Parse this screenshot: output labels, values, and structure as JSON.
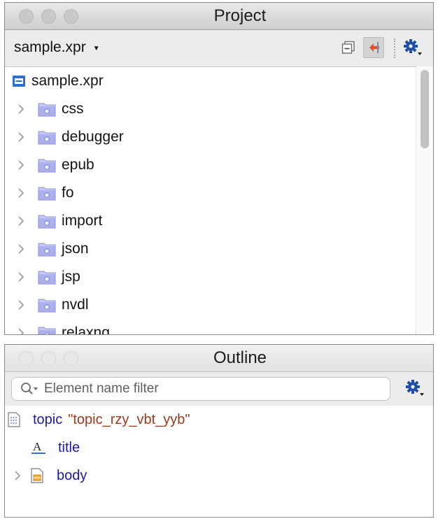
{
  "project_panel": {
    "title": "Project",
    "project_selector": "sample.xpr",
    "root_label": "sample.xpr",
    "folders": [
      "css",
      "debugger",
      "epub",
      "fo",
      "import",
      "json",
      "jsp",
      "nvdl",
      "relaxng"
    ]
  },
  "outline_panel": {
    "title": "Outline",
    "filter_placeholder": "Element name filter",
    "nodes": [
      {
        "element": "topic",
        "attribute": "\"topic_rzy_vbt_yyb\"",
        "icon": "topic-document-icon"
      },
      {
        "element": "title",
        "icon": "text-element-icon"
      },
      {
        "element": "body",
        "icon": "body-element-icon"
      }
    ]
  },
  "colors": {
    "element_name": "#1a1aa8",
    "attribute_value": "#a0391d",
    "folder_icon": "#8f8fe0",
    "link_arrow": "#e0502a",
    "settings_gear": "#1f4ea8"
  }
}
